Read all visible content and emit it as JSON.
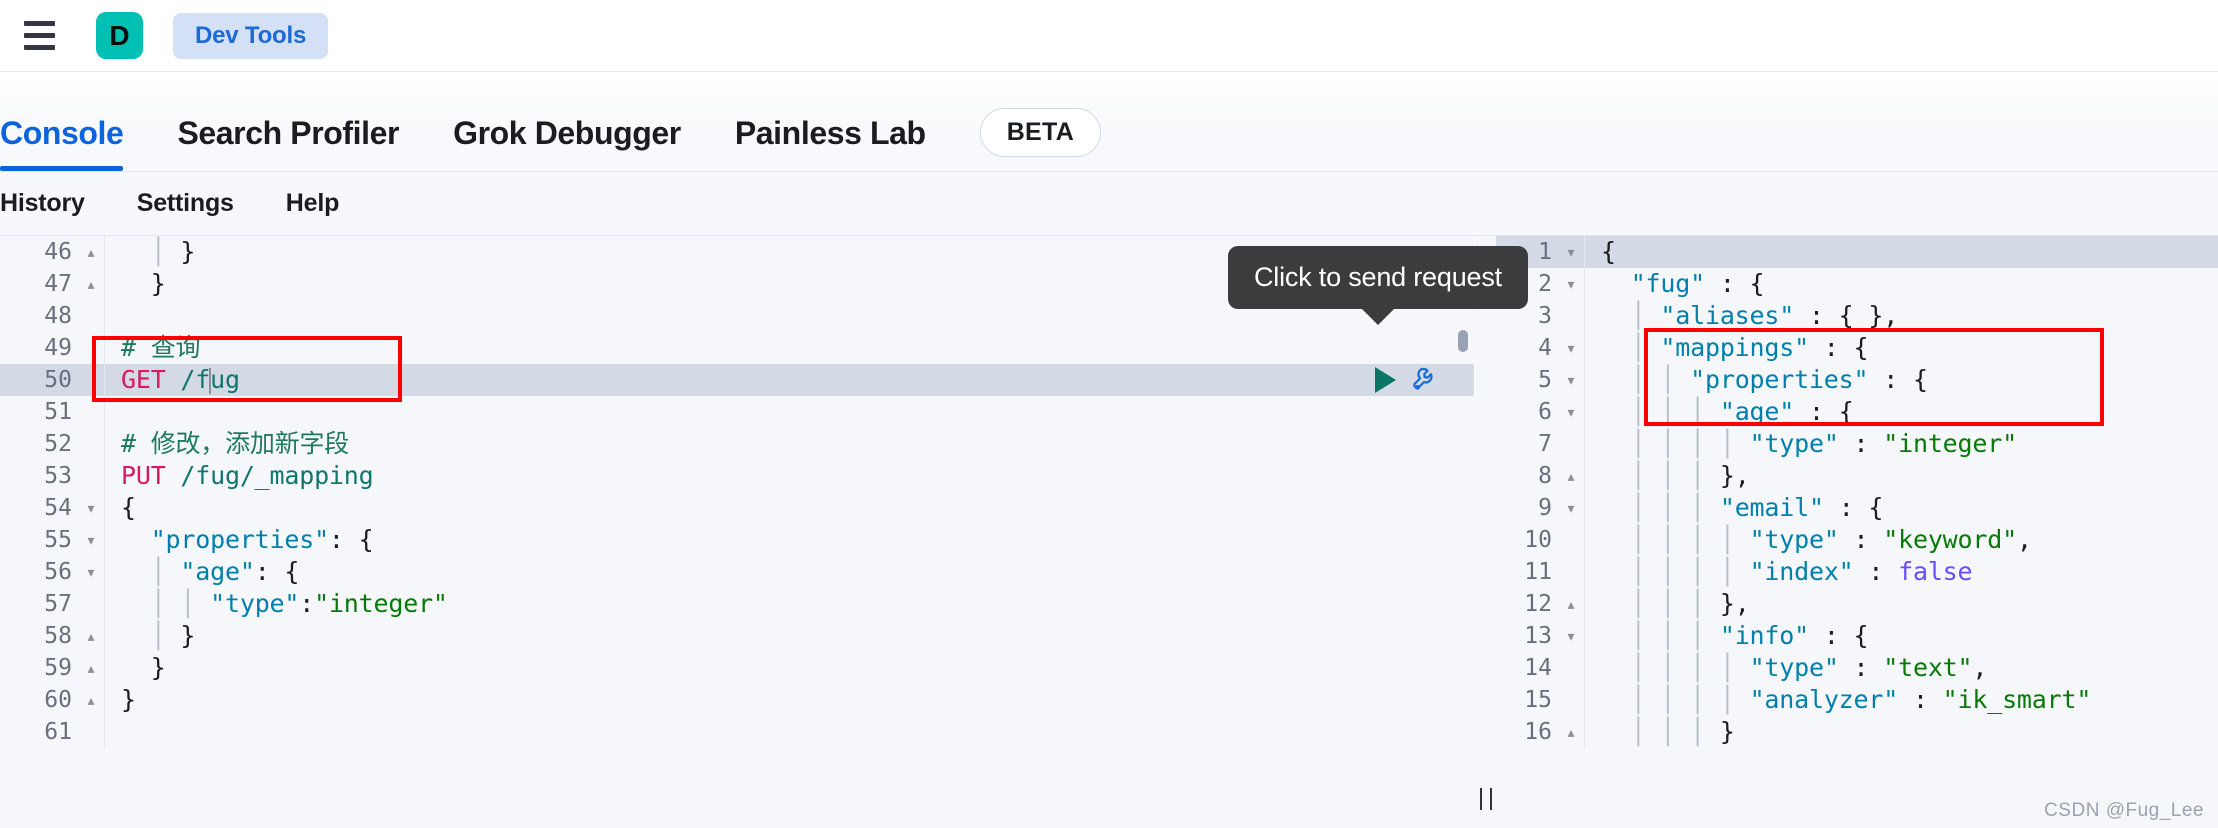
{
  "chrome": {
    "menu_icon": "hamburger-icon",
    "logo_letter": "D",
    "devtools_label": "Dev Tools",
    "logo_color": "#00bfb3",
    "devtools_pill_bg": "#d3e0f5",
    "devtools_text_color": "#1a6bd6"
  },
  "tabs": {
    "items": [
      {
        "label": "Console",
        "active": true
      },
      {
        "label": "Search Profiler",
        "active": false
      },
      {
        "label": "Grok Debugger",
        "active": false
      },
      {
        "label": "Painless Lab",
        "active": false
      }
    ],
    "badge": "BETA",
    "active_color": "#0b64dd"
  },
  "subnav": {
    "items": [
      {
        "label": "History"
      },
      {
        "label": "Settings"
      },
      {
        "label": "Help"
      }
    ]
  },
  "tooltip": {
    "text": "Click to send request",
    "bg": "#3b3c3e"
  },
  "line_actions": {
    "play_icon": "play-triangle-icon",
    "wrench_icon": "wrench-icon",
    "play_color": "#0b7566",
    "wrench_color": "#1a6bd6"
  },
  "request_editor": {
    "name": "console-request-editor",
    "active_line": 50,
    "highlight_color": "#d3dae6",
    "lines": [
      {
        "n": "46",
        "fold": "up",
        "text": "    }"
      },
      {
        "n": "47",
        "fold": "up",
        "text": "  }"
      },
      {
        "n": "48",
        "fold": "",
        "text": ""
      },
      {
        "n": "49",
        "fold": "",
        "text": "# 查询"
      },
      {
        "n": "50",
        "fold": "",
        "text": "GET /fug"
      },
      {
        "n": "51",
        "fold": "",
        "text": ""
      },
      {
        "n": "52",
        "fold": "",
        "text": "# 修改，添加新字段"
      },
      {
        "n": "53",
        "fold": "",
        "text": "PUT /fug/_mapping"
      },
      {
        "n": "54",
        "fold": "down",
        "text": "{"
      },
      {
        "n": "55",
        "fold": "down",
        "text": "  \"properties\": {"
      },
      {
        "n": "56",
        "fold": "down",
        "text": "    \"age\": {"
      },
      {
        "n": "57",
        "fold": "",
        "text": "      \"type\":\"integer\""
      },
      {
        "n": "58",
        "fold": "up",
        "text": "    }"
      },
      {
        "n": "59",
        "fold": "up",
        "text": "  }"
      },
      {
        "n": "60",
        "fold": "up",
        "text": "}"
      },
      {
        "n": "61",
        "fold": "",
        "text": ""
      }
    ]
  },
  "response_editor": {
    "name": "console-response-viewer",
    "active_line": 1,
    "lines": [
      {
        "n": "1",
        "fold": "down",
        "text": "{"
      },
      {
        "n": "2",
        "fold": "down",
        "text": "  \"fug\" : {"
      },
      {
        "n": "3",
        "fold": "",
        "text": "    \"aliases\" : { },"
      },
      {
        "n": "4",
        "fold": "down",
        "text": "    \"mappings\" : {"
      },
      {
        "n": "5",
        "fold": "down",
        "text": "      \"properties\" : {"
      },
      {
        "n": "6",
        "fold": "down",
        "text": "        \"age\" : {"
      },
      {
        "n": "7",
        "fold": "",
        "text": "          \"type\" : \"integer\""
      },
      {
        "n": "8",
        "fold": "up",
        "text": "        },"
      },
      {
        "n": "9",
        "fold": "down",
        "text": "        \"email\" : {"
      },
      {
        "n": "10",
        "fold": "",
        "text": "          \"type\" : \"keyword\","
      },
      {
        "n": "11",
        "fold": "",
        "text": "          \"index\" : false"
      },
      {
        "n": "12",
        "fold": "up",
        "text": "        },"
      },
      {
        "n": "13",
        "fold": "down",
        "text": "        \"info\" : {"
      },
      {
        "n": "14",
        "fold": "",
        "text": "          \"type\" : \"text\","
      },
      {
        "n": "15",
        "fold": "",
        "text": "          \"analyzer\" : \"ik_smart\""
      },
      {
        "n": "16",
        "fold": "up",
        "text": "        }"
      }
    ]
  },
  "annotations": {
    "left_box_color": "#ff0000",
    "right_box_color": "#ff0000",
    "left_box_covers": "lines 49-50",
    "right_box_covers": "lines 6-8"
  },
  "watermark": {
    "text": "CSDN @Fug_Lee"
  }
}
